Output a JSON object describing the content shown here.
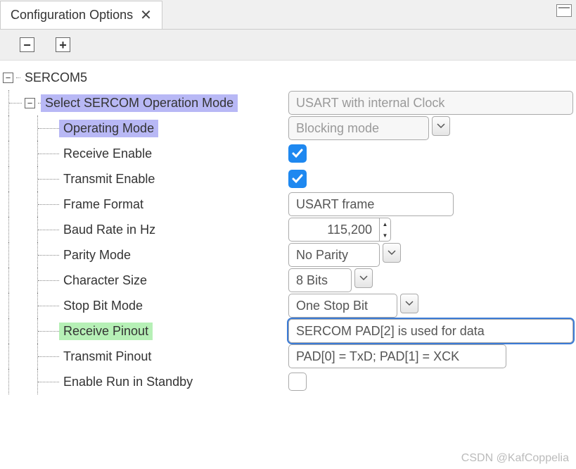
{
  "tab": {
    "title": "Configuration Options"
  },
  "tree": {
    "root": "SERCOM5",
    "modeGroup": "Select SERCOM Operation Mode",
    "modeValue": "USART with internal Clock",
    "rows": [
      {
        "label": "Operating Mode",
        "value": "Blocking mode"
      },
      {
        "label": "Receive Enable"
      },
      {
        "label": "Transmit Enable"
      },
      {
        "label": "Frame Format",
        "value": "USART frame"
      },
      {
        "label": "Baud Rate in Hz",
        "value": "115,200"
      },
      {
        "label": "Parity Mode",
        "value": "No Parity"
      },
      {
        "label": "Character Size",
        "value": "8 Bits"
      },
      {
        "label": "Stop Bit Mode",
        "value": "One Stop Bit"
      },
      {
        "label": "Receive Pinout",
        "value": "SERCOM PAD[2] is used for data"
      },
      {
        "label": "Transmit Pinout",
        "value": "PAD[0] = TxD; PAD[1] = XCK"
      },
      {
        "label": "Enable Run in Standby"
      }
    ]
  },
  "watermark": "CSDN @KafCoppelia"
}
